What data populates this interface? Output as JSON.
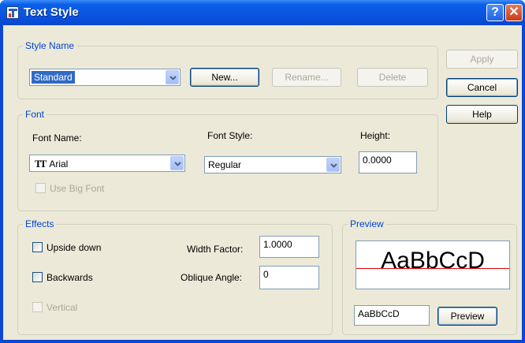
{
  "window": {
    "title": "Text Style"
  },
  "titlebar": {
    "help_glyph": "?",
    "close_glyph": "✕"
  },
  "style_name": {
    "group_label": "Style Name",
    "selected": "Standard",
    "new_button": "New...",
    "rename_button": "Rename...",
    "delete_button": "Delete"
  },
  "side_buttons": {
    "apply": "Apply",
    "cancel": "Cancel",
    "help": "Help"
  },
  "font": {
    "group_label": "Font",
    "font_name_label": "Font Name:",
    "font_name_value": "Arial",
    "font_style_label": "Font Style:",
    "font_style_value": "Regular",
    "height_label": "Height:",
    "height_value": "0.0000",
    "use_big_font": "Use Big Font"
  },
  "effects": {
    "group_label": "Effects",
    "upside_down": "Upside down",
    "backwards": "Backwards",
    "vertical": "Vertical",
    "width_factor_label": "Width Factor:",
    "width_factor_value": "1.0000",
    "oblique_angle_label": "Oblique Angle:",
    "oblique_angle_value": "0"
  },
  "preview": {
    "group_label": "Preview",
    "sample_text": "AaBbCcD",
    "input_value": "AaBbCcD",
    "button": "Preview"
  },
  "colors": {
    "title_blue": "#0a54df",
    "dialog_bg": "#ece9d8",
    "group_label": "#0046d5",
    "baseline_red": "#e00000"
  }
}
